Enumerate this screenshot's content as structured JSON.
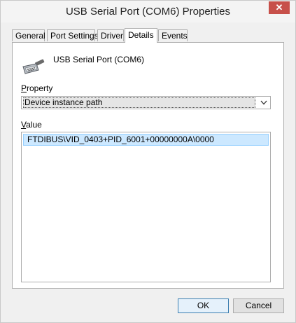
{
  "window": {
    "title": "USB Serial Port (COM6) Properties",
    "close_label": "✕"
  },
  "tabs": [
    {
      "label": "General"
    },
    {
      "label": "Port Settings"
    },
    {
      "label": "Driver"
    },
    {
      "label": "Details",
      "active": true
    },
    {
      "label": "Events"
    }
  ],
  "device": {
    "name": "USB Serial Port (COM6)",
    "icon": "serial-port-icon"
  },
  "property": {
    "label_accel": "P",
    "label_rest": "roperty",
    "selected": "Device instance path"
  },
  "value": {
    "label_accel": "V",
    "label_rest": "alue",
    "items": [
      "FTDIBUS\\VID_0403+PID_6001+00000000A\\0000"
    ]
  },
  "buttons": {
    "ok": "OK",
    "cancel": "Cancel"
  },
  "colors": {
    "close": "#c7504a",
    "selection": "#cce8ff",
    "selection_border": "#99d1ff"
  }
}
